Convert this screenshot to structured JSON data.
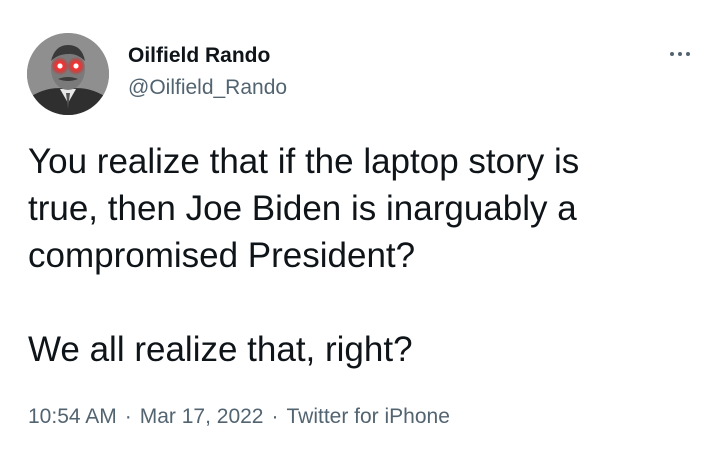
{
  "author": {
    "display_name": "Oilfield Rando",
    "handle": "@Oilfield_Rando",
    "avatar_icon": "avatar-photo-glowing-red-eyes"
  },
  "tweet": {
    "paragraphs": [
      "You realize that if the laptop story is\ntrue, then Joe Biden is inarguably a\ncompromised President?",
      "We all realize that, right?"
    ]
  },
  "meta": {
    "time": "10:54 AM",
    "separator": "·",
    "date": "Mar 17, 2022",
    "source": "Twitter for iPhone"
  },
  "icons": {
    "more": "more-horizontal-icon"
  },
  "colors": {
    "text_primary": "#0f1419",
    "text_secondary": "#536471",
    "avatar_eyes": "#ff2a2a"
  }
}
